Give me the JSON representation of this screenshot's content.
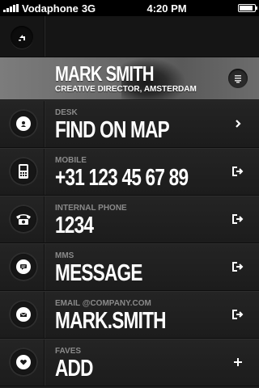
{
  "status": {
    "carrier": "Vodaphone",
    "network": "3G",
    "time": "4:20 PM"
  },
  "profile": {
    "name": "MARK SMITH",
    "title": "CREATIVE DIRECTOR, AMSTERDAM"
  },
  "rows": [
    {
      "label": "DESK",
      "value": "FIND ON MAP",
      "icon": "location-pin-icon",
      "action": "chevron-right-icon"
    },
    {
      "label": "MOBILE",
      "value": "+31 123 45 67 89",
      "icon": "mobile-phone-icon",
      "action": "exit-arrow-icon"
    },
    {
      "label": "INTERNAL PHONE",
      "value": "1234",
      "icon": "telephone-icon",
      "action": "exit-arrow-icon"
    },
    {
      "label": "MMS",
      "value": "MESSAGE",
      "icon": "message-bubble-icon",
      "action": "exit-arrow-icon"
    },
    {
      "label": "EMAIL @COMPANY.COM",
      "value": "MARK.SMITH",
      "icon": "envelope-icon",
      "action": "exit-arrow-icon"
    },
    {
      "label": "FAVES",
      "value": "ADD",
      "icon": "heart-icon",
      "action": "plus-icon"
    }
  ]
}
